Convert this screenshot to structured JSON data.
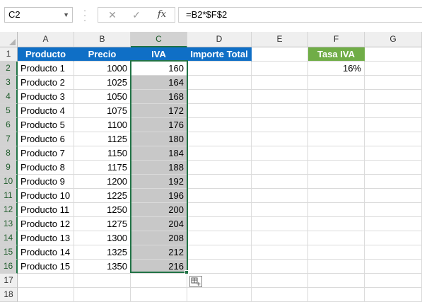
{
  "formula_bar": {
    "name_box": "C2",
    "cancel_icon": "✕",
    "enter_icon": "✓",
    "fx_label": "fx",
    "formula": "=B2*$F$2"
  },
  "columns": [
    "A",
    "B",
    "C",
    "D",
    "E",
    "F",
    "G"
  ],
  "rows": [
    "1",
    "2",
    "3",
    "4",
    "5",
    "6",
    "7",
    "8",
    "9",
    "10",
    "11",
    "12",
    "13",
    "14",
    "15",
    "16",
    "17",
    "18"
  ],
  "headers": {
    "producto": "Producto",
    "precio": "Precio",
    "iva": "IVA",
    "importe_total": "Importe Total",
    "tasa_iva": "Tasa IVA"
  },
  "tasa_iva_value": "16%",
  "products": [
    {
      "name": "Producto 1",
      "precio": "1000",
      "iva": "160"
    },
    {
      "name": "Producto 2",
      "precio": "1025",
      "iva": "164"
    },
    {
      "name": "Producto 3",
      "precio": "1050",
      "iva": "168"
    },
    {
      "name": "Producto 4",
      "precio": "1075",
      "iva": "172"
    },
    {
      "name": "Producto 5",
      "precio": "1100",
      "iva": "176"
    },
    {
      "name": "Producto 6",
      "precio": "1125",
      "iva": "180"
    },
    {
      "name": "Producto 7",
      "precio": "1150",
      "iva": "184"
    },
    {
      "name": "Producto 8",
      "precio": "1175",
      "iva": "188"
    },
    {
      "name": "Producto 9",
      "precio": "1200",
      "iva": "192"
    },
    {
      "name": "Producto 10",
      "precio": "1225",
      "iva": "196"
    },
    {
      "name": "Producto 11",
      "precio": "1250",
      "iva": "200"
    },
    {
      "name": "Producto 12",
      "precio": "1275",
      "iva": "204"
    },
    {
      "name": "Producto 13",
      "precio": "1300",
      "iva": "208"
    },
    {
      "name": "Producto 14",
      "precio": "1325",
      "iva": "212"
    },
    {
      "name": "Producto 15",
      "precio": "1350",
      "iva": "216"
    }
  ],
  "colors": {
    "header_blue": "#0f6fc6",
    "header_green": "#70ad47",
    "selection_green": "#217346",
    "selection_fill": "#c8c8c8"
  },
  "icons": {
    "name_box_dropdown": "chevron-down-icon",
    "cancel": "close-icon",
    "enter": "check-icon",
    "function": "fx-icon",
    "quick_analysis": "quick-analysis-icon"
  }
}
